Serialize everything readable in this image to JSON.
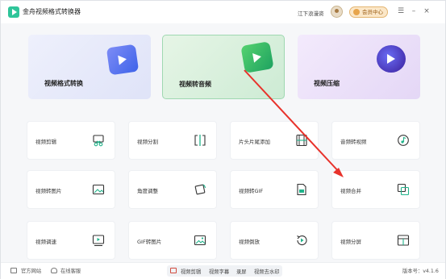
{
  "app": {
    "title": "金舟视频格式转换器"
  },
  "header": {
    "username": "江下浪漫资",
    "vip_label": "会员中心",
    "menu_glyph": "☰",
    "minimize_glyph": "–",
    "close_glyph": "×"
  },
  "big_cards": [
    {
      "label": "视频格式转换",
      "icon": "video-convert-icon"
    },
    {
      "label": "视频转音频",
      "icon": "video-to-audio-icon"
    },
    {
      "label": "视频压缩",
      "icon": "video-compress-icon"
    }
  ],
  "tools": [
    {
      "label": "视频剪辑",
      "icon": "scissors-icon"
    },
    {
      "label": "视频分割",
      "icon": "split-icon"
    },
    {
      "label": "片头片尾添加",
      "icon": "film-strip-icon"
    },
    {
      "label": "音频转视频",
      "icon": "music-note-icon"
    },
    {
      "label": "视频转图片",
      "icon": "image-icon"
    },
    {
      "label": "角度调整",
      "icon": "rotate-icon"
    },
    {
      "label": "视频转GIF",
      "icon": "gif-icon"
    },
    {
      "label": "视频合并",
      "icon": "merge-icon"
    },
    {
      "label": "视频调速",
      "icon": "speed-icon"
    },
    {
      "label": "GIF转图片",
      "icon": "gif-image-icon"
    },
    {
      "label": "视频倒放",
      "icon": "reverse-icon"
    },
    {
      "label": "视频分屏",
      "icon": "split-screen-icon"
    }
  ],
  "footer": {
    "website": "官方网站",
    "support": "在线客服",
    "pills": [
      "视频剪辑",
      "视频字幕",
      "录屏",
      "视频去水印"
    ],
    "version": "版本号：v4.1.6"
  },
  "colors": {
    "accent_green": "#2fc59a",
    "arrow_red": "#e8322b",
    "vip_gold": "#e4b571"
  }
}
